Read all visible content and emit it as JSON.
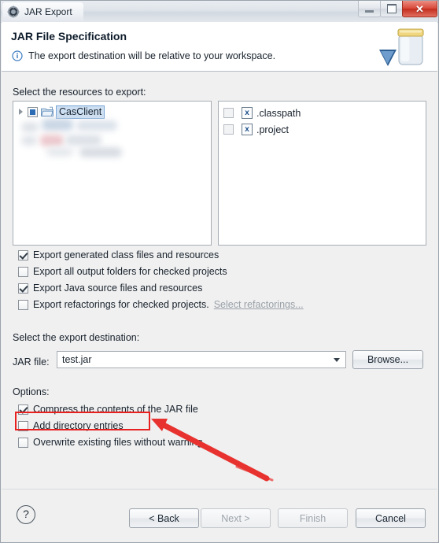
{
  "window": {
    "title": "JAR Export",
    "icon": "jar-export-icon",
    "buttons": {
      "minimize": "minimize-icon",
      "maximize": "maximize-icon",
      "close": "✕"
    }
  },
  "header": {
    "title": "JAR File Specification",
    "subtitle": "The export destination will be relative to your workspace.",
    "info_icon": "info-icon",
    "banner_icon": "jar-jar-icon"
  },
  "resources": {
    "label": "Select the resources to export:",
    "tree": {
      "items": [
        {
          "label": "CasClient",
          "icon": "project-folder-icon",
          "expander": "chevron-right-icon",
          "checkbox": "partial",
          "selected": true
        }
      ],
      "redacted_rows": 3
    },
    "files": {
      "items": [
        {
          "name": ".classpath",
          "icon": "xml-file-icon",
          "checked": false
        },
        {
          "name": ".project",
          "icon": "xml-file-icon",
          "checked": false
        }
      ]
    }
  },
  "export_options": [
    {
      "label": "Export generated class files and resources",
      "checked": true,
      "enabled": true
    },
    {
      "label": "Export all output folders for checked projects",
      "checked": false,
      "enabled": true
    },
    {
      "label": "Export Java source files and resources",
      "checked": true,
      "enabled": true
    },
    {
      "label": "Export refactorings for checked projects.",
      "checked": false,
      "enabled": true,
      "link": "Select refactorings..."
    }
  ],
  "destination": {
    "label": "Select the export destination:",
    "jar_file_label": "JAR file:",
    "jar_file_value": "test.jar",
    "jar_file_placeholder": "",
    "browse_label": "Browse..."
  },
  "options": {
    "label": "Options:",
    "items": [
      {
        "label": "Compress the contents of the JAR file",
        "checked": true
      },
      {
        "label": "Add directory entries",
        "checked": false,
        "highlighted": true
      },
      {
        "label": "Overwrite existing files without warning",
        "checked": false
      }
    ]
  },
  "footer": {
    "help": "?",
    "back": "< Back",
    "next": "Next >",
    "finish": "Finish",
    "cancel": "Cancel"
  },
  "annotation": {
    "highlight_color": "#e8201f",
    "arrow_color": "#e8322f"
  }
}
